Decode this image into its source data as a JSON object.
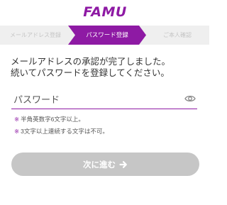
{
  "brand": {
    "logo_text": "FAMU",
    "accent_color": "#8e1aa4"
  },
  "steps": [
    {
      "label": "メールアドレス登録",
      "state": "done"
    },
    {
      "label": "パスワード登録",
      "state": "current"
    },
    {
      "label": "ご本人確認",
      "state": "upcoming"
    }
  ],
  "message": {
    "line1": "メールアドレスの承認が完了しました。",
    "line2": "続いてパスワードを登録してください。"
  },
  "password": {
    "placeholder": "パスワード",
    "value": "",
    "toggle_icon": "eye-icon"
  },
  "rules": [
    {
      "mark": "※",
      "text": "半角英数字6文字以上。"
    },
    {
      "mark": "※",
      "text": "3文字以上連続する文字は不可。"
    }
  ],
  "next_button": {
    "label": "次に進む",
    "icon": "arrow-right-icon",
    "disabled_color": "#c6c6c6"
  }
}
